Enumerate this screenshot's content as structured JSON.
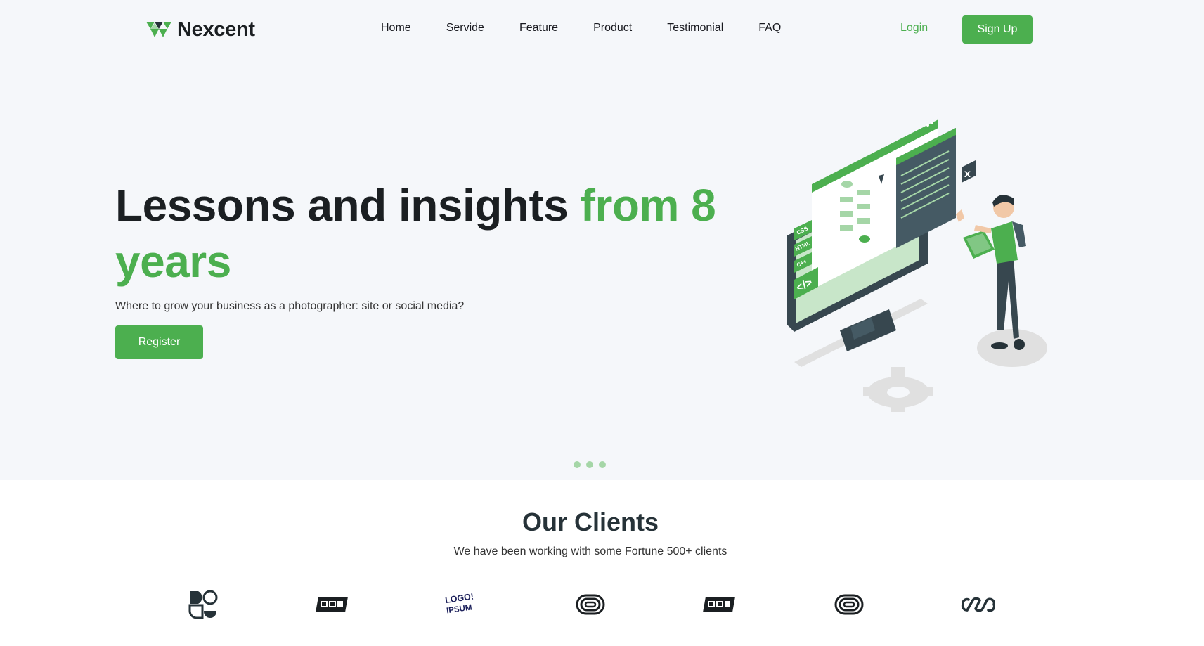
{
  "brand": {
    "name": "Nexcent",
    "accent_color": "#4caf4f",
    "icon": "nexcent-triangle-logo-icon"
  },
  "nav": {
    "links": [
      "Home",
      "Servide",
      "Feature",
      "Product",
      "Testimonial",
      "FAQ"
    ],
    "login_label": "Login",
    "signup_label": "Sign Up"
  },
  "hero": {
    "headline_main": "Lessons and insights ",
    "headline_accent": "from 8 years",
    "subtext": "Where to grow your business as a photographer: site or social media?",
    "cta_label": "Register",
    "illustration": "developer-with-monitor-illustration",
    "carousel_dots": 3
  },
  "clients": {
    "title": "Our Clients",
    "subtitle": "We have been working with some Fortune 500+ clients",
    "logos": [
      "client-logo-1-icon",
      "client-logo-2-icon",
      "logo-ipsum-icon",
      "client-logo-4-icon",
      "client-logo-5-icon",
      "client-logo-6-icon",
      "client-logo-7-icon"
    ],
    "logo_ipsum_text": "LOGO IPSUM"
  }
}
